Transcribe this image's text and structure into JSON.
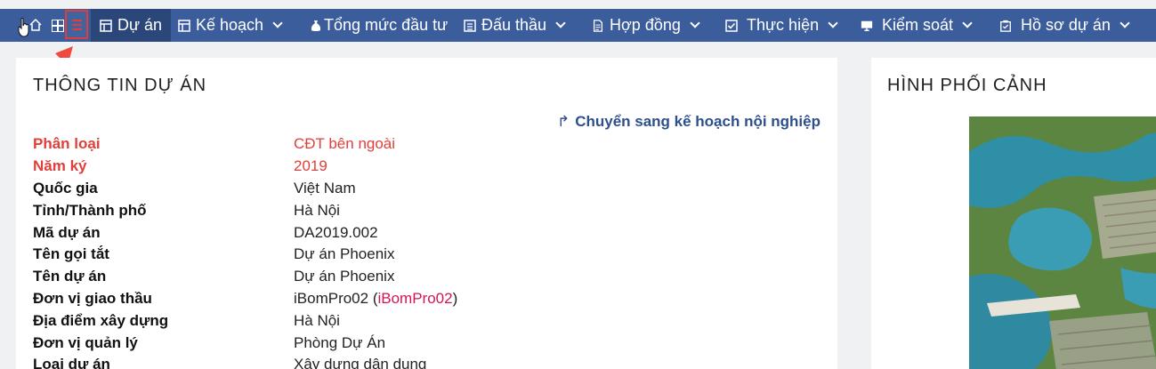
{
  "navbar": {
    "items": [
      {
        "label": "Dự án",
        "icon": "project-icon",
        "active": true,
        "dropdown": false
      },
      {
        "label": "Kế hoạch",
        "icon": "plan-icon",
        "dropdown": true
      },
      {
        "label": "Tổng mức đầu tư",
        "icon": "money-bag-icon",
        "dropdown": false
      },
      {
        "label": "Đấu thầu",
        "icon": "bidding-icon",
        "dropdown": true
      },
      {
        "label": "Hợp đồng",
        "icon": "contract-icon",
        "dropdown": true
      },
      {
        "label": "Thực hiện",
        "icon": "checkbox-icon",
        "dropdown": true
      },
      {
        "label": "Kiểm soát",
        "icon": "monitor-icon",
        "dropdown": true
      },
      {
        "label": "Hồ sơ dự án",
        "icon": "document-check-icon",
        "dropdown": true
      }
    ]
  },
  "project_info": {
    "title": "THÔNG TIN DỰ ÁN",
    "convert_link": "Chuyển sang kế hoạch nội nghiệp",
    "fields": [
      {
        "label": "Phân loại",
        "value": "CĐT bên ngoài",
        "highlight": true
      },
      {
        "label": "Năm ký",
        "value": "2019",
        "highlight": true
      },
      {
        "label": "Quốc gia",
        "value": "Việt Nam"
      },
      {
        "label": "Tỉnh/Thành phố",
        "value": "Hà Nội"
      },
      {
        "label": "Mã dự án",
        "value": "DA2019.002"
      },
      {
        "label": "Tên gọi tắt",
        "value": "Dự án Phoenix"
      },
      {
        "label": "Tên dự án",
        "value": "Dự án Phoenix"
      },
      {
        "label": "Đơn vị giao thầu",
        "value": "iBomPro02 (",
        "code": "iBomPro02",
        "suffix": ")"
      },
      {
        "label": "Địa điểm xây dựng",
        "value": "Hà Nội"
      },
      {
        "label": "Đơn vị quản lý",
        "value": "Phòng Dự Án"
      },
      {
        "label": "Loại dự án",
        "value": "Xây dựng dân dụng"
      }
    ]
  },
  "perspective": {
    "title": "HÌNH PHỐI CẢNH"
  },
  "colors": {
    "navbar": "#3b5d9b",
    "navbar_active": "#2b4679",
    "highlight": "#e0403a",
    "link": "#2d4f8c",
    "annotation": "#e23b3b"
  }
}
